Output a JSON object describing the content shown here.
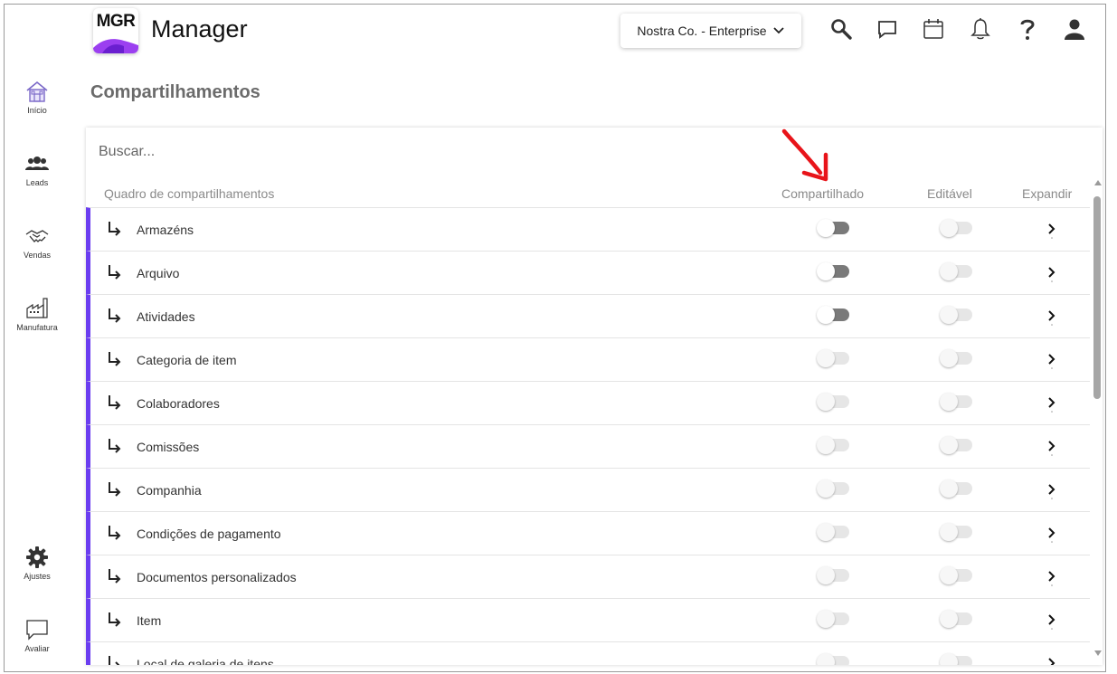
{
  "app": {
    "logo_text": "MGR",
    "title": "Manager"
  },
  "header": {
    "company_selector": "Nostra Co. - Enterprise"
  },
  "sidebar": {
    "items": [
      {
        "label": "Início",
        "icon": "home-icon"
      },
      {
        "label": "Leads",
        "icon": "users-icon"
      },
      {
        "label": "Vendas",
        "icon": "handshake-icon"
      },
      {
        "label": "Manufatura",
        "icon": "factory-icon"
      },
      {
        "label": "Ajustes",
        "icon": "gear-icon"
      },
      {
        "label": "Avaliar",
        "icon": "feedback-icon"
      }
    ]
  },
  "page": {
    "title": "Compartilhamentos"
  },
  "search": {
    "placeholder": "Buscar..."
  },
  "table": {
    "columns": {
      "name": "Quadro de compartilhamentos",
      "shared": "Compartilhado",
      "editable": "Editável",
      "expand": "Expandir"
    },
    "rows": [
      {
        "label": "Armazéns",
        "shared": "on",
        "editable": "off"
      },
      {
        "label": "Arquivo",
        "shared": "on",
        "editable": "off"
      },
      {
        "label": "Atividades",
        "shared": "on",
        "editable": "off"
      },
      {
        "label": "Categoria de item",
        "shared": "off",
        "editable": "off"
      },
      {
        "label": "Colaboradores",
        "shared": "off",
        "editable": "off"
      },
      {
        "label": "Comissões",
        "shared": "off",
        "editable": "off"
      },
      {
        "label": "Companhia",
        "shared": "off",
        "editable": "off"
      },
      {
        "label": "Condições de pagamento",
        "shared": "off",
        "editable": "off"
      },
      {
        "label": "Documentos personalizados",
        "shared": "off",
        "editable": "off"
      },
      {
        "label": "Item",
        "shared": "off",
        "editable": "off"
      },
      {
        "label": "Local de galeria de itens",
        "shared": "off",
        "editable": "off"
      }
    ]
  },
  "colors": {
    "accent": "#6a3df0",
    "logo_purple": "#9b3ff0",
    "annotation": "#e8141a"
  }
}
